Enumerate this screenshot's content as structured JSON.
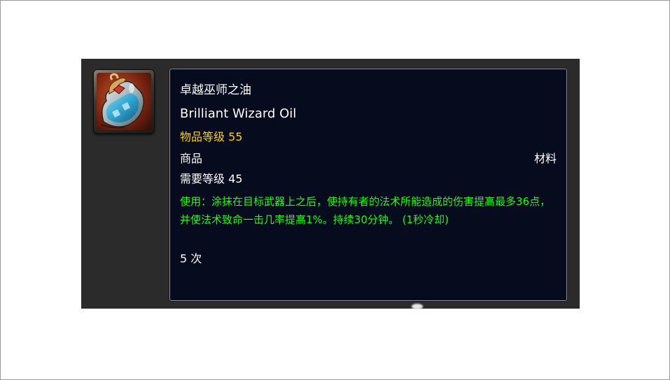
{
  "item": {
    "name_cn": "卓越巫师之油",
    "name_en": "Brilliant Wizard Oil",
    "item_level": "物品等级 55",
    "category": "商品",
    "subtype": "材料",
    "required_level": "需要等级 45",
    "use_text": "使用：涂抹在目标武器上之后，使持有者的法术所能造成的伤害提高最多36点，并使法术致命一击几率提高1%。持续30分钟。 (1秒冷却)",
    "charges": "5 次",
    "icon": "wizard-oil-flask-icon"
  },
  "colors": {
    "item_level": "#ffd100",
    "use_effect": "#1eff00",
    "tooltip_bg": "#070b1e"
  }
}
